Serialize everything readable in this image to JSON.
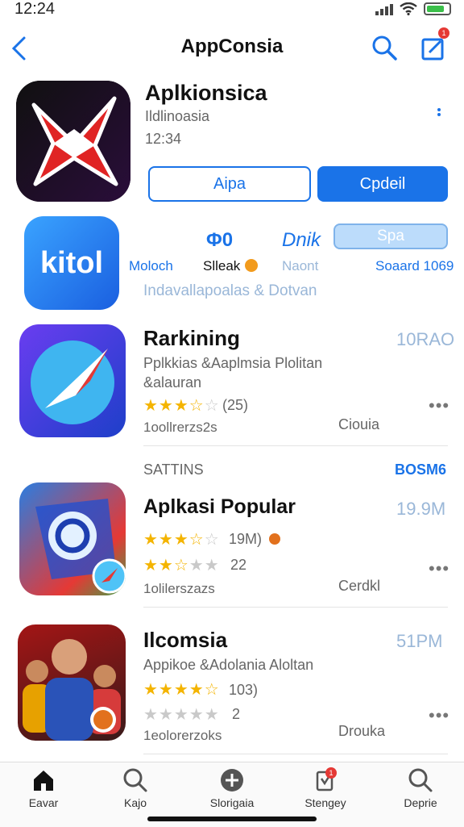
{
  "status": {
    "time": "12:24"
  },
  "header": {
    "title": "AppConsia",
    "notification_count": "1"
  },
  "featured": {
    "name": "Aplkionsica",
    "subtitle": "Ildlinoasia",
    "time": "12:34",
    "btn_outline": "Aipa",
    "btn_primary": "Cpdeil"
  },
  "promo": {
    "icon_text": "kitol",
    "price": "Φ0",
    "price2": "Dnik",
    "label1": "Moloch",
    "label2": "Slleak",
    "label3": "Naont",
    "label4": "Soaard 1069",
    "pill": "Spa",
    "caption": "Indavallapoalas & Dotvan"
  },
  "ranking": {
    "title": "Rarkining",
    "size": "10RAO",
    "desc1": "Pplkkias &Aaplmsia Plolitan",
    "desc2": "&alauran",
    "rating_count": "(25)",
    "date": "1oollrerzs2s",
    "tag": "Ciouia",
    "stars": 3.5
  },
  "section": {
    "title": "SATTINS",
    "right": "BOSM6"
  },
  "popular": {
    "title": "Aplkasi Popular",
    "size": "19.9M",
    "row1_text": "19M)",
    "row2_count": "22",
    "date": "1olilerszazs",
    "tag": "Cerdkl",
    "stars1": 3.5,
    "stars2": 2.5
  },
  "third": {
    "title": "Ilcomsia",
    "size": "51PM",
    "desc": "Appikoe &Adolania Aloltan",
    "row1_text": "103)",
    "row2_count": "2",
    "date": "1eolorerzoks",
    "tag": "Drouka",
    "stars1": 4.5,
    "stars2": 0
  },
  "tabs": [
    {
      "label": "Eavar",
      "icon": "home-icon"
    },
    {
      "label": "Kajo",
      "icon": "search-icon"
    },
    {
      "label": "Slorigaia",
      "icon": "plus-circle-icon"
    },
    {
      "label": "Stengey",
      "icon": "updates-icon",
      "badge": "1"
    },
    {
      "label": "Deprie",
      "icon": "search-icon"
    }
  ],
  "colors": {
    "accent": "#1a73e8",
    "star": "#f4b400"
  }
}
